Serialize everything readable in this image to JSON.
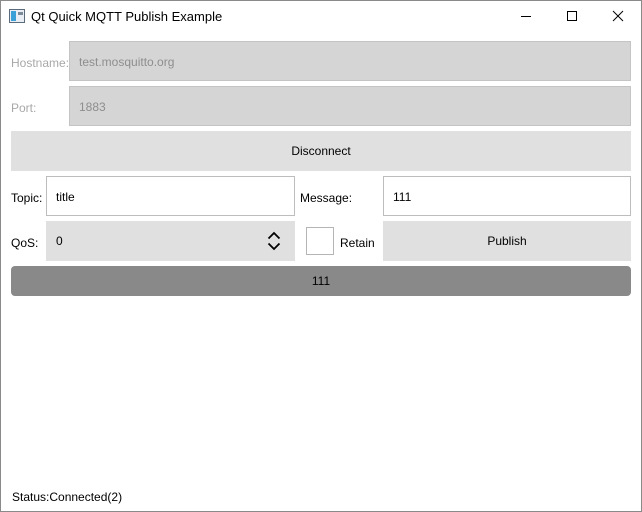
{
  "window": {
    "title": "Qt Quick MQTT Publish Example"
  },
  "connection": {
    "hostname_label": "Hostname:",
    "hostname_value": "test.mosquitto.org",
    "port_label": "Port:",
    "port_value": "1883",
    "disconnect_label": "Disconnect"
  },
  "publish": {
    "topic_label": "Topic:",
    "topic_value": "title",
    "message_label": "Message:",
    "message_value": "111",
    "qos_label": "QoS:",
    "qos_value": "0",
    "retain_label": "Retain",
    "retain_checked": false,
    "publish_label": "Publish"
  },
  "message_list": {
    "items": [
      "111"
    ]
  },
  "status": {
    "text": "Status:Connected(2)"
  },
  "icons": {
    "app": "app-window-icon",
    "minimize": "minimize-icon",
    "maximize": "maximize-icon",
    "close": "close-icon",
    "spin": "chevron-up-down-icon"
  },
  "colors": {
    "disabled_field_bg": "#d5d5d5",
    "button_bg": "#e0e0e0",
    "message_bar_bg": "#898989",
    "disabled_text": "#a8a8a8"
  }
}
